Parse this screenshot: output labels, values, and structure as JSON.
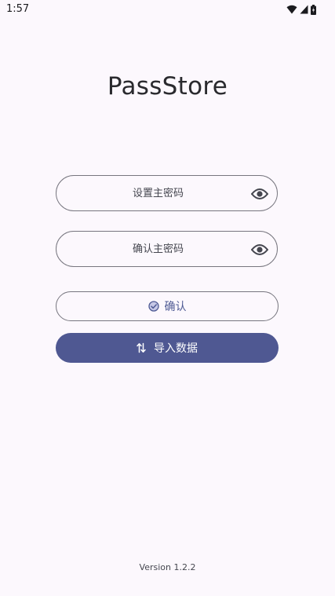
{
  "status_bar": {
    "time": "1:57",
    "icons": [
      "wifi-icon",
      "cell-signal-icon",
      "battery-charging-icon"
    ]
  },
  "app": {
    "title": "PassStore"
  },
  "form": {
    "set_password_placeholder": "设置主密码",
    "confirm_password_placeholder": "确认主密码",
    "visibility_icon": "eye-icon",
    "confirm_button_label": "确认",
    "confirm_button_icon": "check-circle-icon",
    "import_button_label": "导入数据",
    "import_button_icon": "swap-vertical-icon"
  },
  "footer": {
    "version": "Version 1.2.2"
  },
  "colors": {
    "background": "#fcf8fd",
    "primary": "#4f5892",
    "outline": "#77767f",
    "on_surface": "#1b1b1f"
  }
}
